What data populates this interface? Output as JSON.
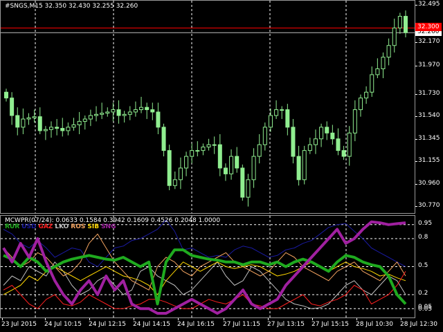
{
  "chart": {
    "title": "#SNGS,M15",
    "ohlc_header": "32.350 32.430 32.255 32.260",
    "bid_price": "32.260",
    "ask_label": "32.300",
    "price_ticks": [
      "32.495",
      "32.260",
      "32.170",
      "31.970",
      "31.730",
      "31.540",
      "31.345",
      "31.155",
      "30.960",
      "30.770"
    ],
    "candle_color": "#90ee90",
    "background": "#000000",
    "bid_line_color": "#c0c0c0",
    "ask_line_color": "#ff0000"
  },
  "indicator": {
    "header": "MCWPR(07/24): 0.0633 0.1584 0.3942 0.1609 0.4526 0.2048 1.0000",
    "ticks": [
      "0.95",
      "0.8",
      "0.5",
      "0.2",
      "0.05",
      "0.05"
    ],
    "legend": [
      {
        "label": "RUR",
        "color": "#1faa1f"
      },
      {
        "label": "USD",
        "color": "#1a1aa0"
      },
      {
        "label": "GAZ",
        "color": "#ff2020"
      },
      {
        "label": "LKO",
        "color": "#c0c0c0"
      },
      {
        "label": "ROS",
        "color": "#f4a460"
      },
      {
        "label": "SIB",
        "color": "#ffd700"
      },
      {
        "label": "SNG",
        "color": "#a020a0"
      }
    ]
  },
  "time_axis": [
    "23 Jul 2015",
    "24 Jul 10:15",
    "24 Jul 12:15",
    "24 Jul 14:15",
    "24 Jul 16:15",
    "27 Jul 11:15",
    "27 Jul 13:15",
    "27 Jul 15:15",
    "28 Jul 10:30",
    "28 Jul 12:30"
  ],
  "chart_data": {
    "type": "candlestick",
    "title": "#SNGS,M15",
    "y_ticks": [
      32.495,
      32.26,
      32.17,
      31.97,
      31.73,
      31.54,
      31.345,
      31.155,
      30.96,
      30.77
    ],
    "ylim": [
      30.75,
      32.51
    ],
    "close": [
      31.7,
      31.55,
      31.45,
      31.52,
      31.53,
      31.54,
      31.42,
      31.43,
      31.45,
      31.44,
      31.42,
      31.45,
      31.47,
      31.5,
      31.52,
      31.55,
      31.56,
      31.57,
      31.58,
      31.6,
      31.55,
      31.56,
      31.58,
      31.6,
      31.62,
      31.6,
      31.58,
      31.45,
      31.25,
      30.95,
      31.0,
      31.1,
      31.2,
      31.25,
      31.25,
      31.28,
      31.3,
      31.3,
      31.1,
      31.05,
      31.2,
      31.1,
      30.85,
      31.0,
      31.2,
      31.3,
      31.45,
      31.55,
      31.6,
      31.6,
      31.45,
      31.2,
      31.0,
      31.25,
      31.3,
      31.35,
      31.45,
      31.4,
      31.35,
      31.25,
      31.2,
      31.4,
      31.6,
      31.7,
      31.75,
      31.9,
      31.95,
      32.05,
      32.15,
      32.3,
      32.4,
      32.26
    ],
    "indicator": {
      "name": "MCWPR(07/24)",
      "values": [
        0.0633,
        0.1584,
        0.3942,
        0.1609,
        0.4526,
        0.2048,
        1.0
      ],
      "levels": [
        0.95,
        0.8,
        0.5,
        0.2,
        0.05
      ],
      "ylim": [
        0,
        1
      ],
      "series": [
        {
          "name": "RUR",
          "values": [
            0.62,
            0.58,
            0.5,
            0.6,
            0.55,
            0.45,
            0.5,
            0.55,
            0.58,
            0.6,
            0.62,
            0.6,
            0.58,
            0.57,
            0.6,
            0.55,
            0.5,
            0.55,
            0.1,
            0.55,
            0.68,
            0.68,
            0.62,
            0.6,
            0.58,
            0.57,
            0.55,
            0.55,
            0.52,
            0.55,
            0.55,
            0.52,
            0.55,
            0.5,
            0.55,
            0.58,
            0.55,
            0.5,
            0.45,
            0.55,
            0.62,
            0.6,
            0.55,
            0.52,
            0.5,
            0.4,
            0.2,
            0.1
          ]
        },
        {
          "name": "USD",
          "values": [
            0.9,
            0.85,
            0.75,
            0.7,
            0.78,
            0.7,
            0.6,
            0.65,
            0.7,
            0.68,
            0.55,
            0.5,
            0.6,
            0.7,
            0.72,
            0.78,
            0.8,
            0.85,
            0.9,
            1.0,
            0.88,
            0.68,
            0.7,
            0.65,
            0.6,
            0.62,
            0.6,
            0.68,
            0.72,
            0.7,
            0.65,
            0.6,
            0.62,
            0.68,
            0.7,
            0.75,
            0.78,
            0.85,
            0.92,
            0.95,
            0.96,
            0.88,
            0.8,
            0.7,
            0.65,
            0.6,
            0.55,
            0.5
          ]
        },
        {
          "name": "GAZ",
          "values": [
            0.25,
            0.3,
            0.2,
            0.1,
            0.05,
            0.15,
            0.2,
            0.1,
            0.08,
            0.12,
            0.2,
            0.15,
            0.1,
            0.05,
            0.05,
            0.08,
            0.1,
            0.15,
            0.15,
            0.12,
            0.08,
            0.05,
            0.05,
            0.1,
            0.15,
            0.12,
            0.1,
            0.15,
            0.2,
            0.1,
            0.08,
            0.05,
            0.05,
            0.1,
            0.15,
            0.2,
            0.1,
            0.08,
            0.12,
            0.15,
            0.2,
            0.3,
            0.25,
            0.1,
            0.15,
            0.2,
            0.3,
            0.45
          ]
        },
        {
          "name": "LKO",
          "values": [
            0.3,
            0.4,
            0.35,
            0.5,
            0.45,
            0.4,
            0.55,
            0.45,
            0.3,
            0.2,
            0.25,
            0.35,
            0.4,
            0.3,
            0.2,
            0.25,
            0.45,
            0.5,
            0.4,
            0.35,
            0.3,
            0.2,
            0.25,
            0.35,
            0.45,
            0.55,
            0.4,
            0.3,
            0.35,
            0.5,
            0.45,
            0.35,
            0.25,
            0.15,
            0.1,
            0.08,
            0.05,
            0.06,
            0.1,
            0.2,
            0.3,
            0.35,
            0.25,
            0.2,
            0.3,
            0.4,
            0.35,
            0.2
          ]
        },
        {
          "name": "ROS",
          "values": [
            0.7,
            0.6,
            0.5,
            0.55,
            0.65,
            0.6,
            0.5,
            0.4,
            0.45,
            0.55,
            0.75,
            0.85,
            0.7,
            0.55,
            0.45,
            0.35,
            0.3,
            0.25,
            0.5,
            0.6,
            0.55,
            0.45,
            0.4,
            0.5,
            0.55,
            0.6,
            0.65,
            0.55,
            0.5,
            0.45,
            0.4,
            0.45,
            0.55,
            0.65,
            0.6,
            0.5,
            0.45,
            0.4,
            0.35,
            0.45,
            0.5,
            0.55,
            0.45,
            0.4,
            0.35,
            0.45,
            0.55,
            0.4
          ]
        },
        {
          "name": "SIB",
          "values": [
            0.2,
            0.25,
            0.3,
            0.4,
            0.35,
            0.45,
            0.5,
            0.45,
            0.4,
            0.35,
            0.4,
            0.45,
            0.5,
            0.45,
            0.4,
            0.38,
            0.35,
            0.3,
            0.2,
            0.35,
            0.45,
            0.55,
            0.5,
            0.45,
            0.5,
            0.55,
            0.5,
            0.48,
            0.5,
            0.52,
            0.5,
            0.45,
            0.4,
            0.42,
            0.45,
            0.5,
            0.55,
            0.5,
            0.45,
            0.5,
            0.55,
            0.5,
            0.48,
            0.45,
            0.4,
            0.42,
            0.38,
            0.35
          ]
        },
        {
          "name": "SNG",
          "values": [
            0.7,
            0.55,
            0.75,
            0.6,
            0.8,
            0.55,
            0.35,
            0.2,
            0.1,
            0.25,
            0.35,
            0.2,
            0.4,
            0.25,
            0.35,
            0.1,
            0.05,
            0.05,
            0.0,
            0.0,
            0.05,
            0.1,
            0.15,
            0.1,
            0.05,
            0.0,
            0.05,
            0.15,
            0.25,
            0.1,
            0.05,
            0.1,
            0.15,
            0.3,
            0.4,
            0.5,
            0.6,
            0.7,
            0.8,
            0.9,
            0.75,
            0.8,
            0.9,
            0.98,
            0.97,
            0.95,
            0.96,
            0.97
          ]
        }
      ]
    }
  }
}
